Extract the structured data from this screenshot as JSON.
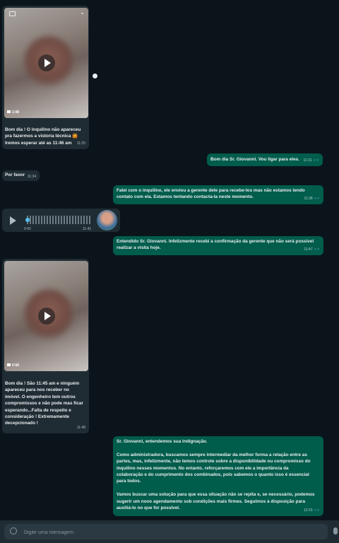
{
  "messages": {
    "m1": {
      "duration": "1:08",
      "text": "Bom dia ! O inquilino não apareceu\npra fazermos a vistoria técnica 🙆\nIremos esperar até as 11:46 am",
      "time": "11:25"
    },
    "m2": {
      "text": "Bom dia Sr. Giovanni. Vou ligar para eles.",
      "time": "11:31"
    },
    "m3": {
      "text": "Por favor",
      "time": "11:34"
    },
    "m4": {
      "text": "Falei com o inquilino, ele enviou a gerente dele para recebe-los mas não estamos tendo\ncontato com ela. Estamos tentando contacta-la neste momento.",
      "time": "11:38"
    },
    "m5": {
      "duration": "0:42",
      "time": "11:41",
      "progress": 0.0
    },
    "m6": {
      "text": "Entendido Sr. Giovanni. Infelizmente recebi a confirmação da gerente que não será possível\nrealizar a visita hoje.",
      "time": "11:47"
    },
    "m7": {
      "duration": "0:56",
      "text": "Bom dia ! São 11:45 am e ninguém\napareceu para nos receber no\nimóvel. O engenheiro tem outros\ncompromissos e não pode mas ficar\nesperando...Falta de respeito e\nconsideração ! Extremamente\ndecepcionado !",
      "time": "11:48"
    },
    "m8": {
      "text": "Sr. Giovanni, entendemos sua indignação.\n\nComo administradora, buscamos sempre intermediar da melhor forma a relação entre as\npartes, mas, infelizmente, não temos controle sobre a disponibilidade ou compromisso do\ninquilino nesses momentos. No entanto, reforçaremos com ele a importância da\ncolaboração e do cumprimento dos combinados, pois sabemos o quanto isso é essencial\npara todos.\n\nVamos buscar uma solução para que essa situação não se repita e, se necessário, podemos\nsugerir um novo agendamento sob condições mais firmes. Seguimos à disposição para\nauxiliá-lo no que for possível.",
      "time": "12:15"
    }
  },
  "composer": {
    "placeholder": "Digite uma mensagem"
  },
  "colors": {
    "background": "#0b141a",
    "incoming": "#202c33",
    "outgoing": "#005c4b",
    "read_check": "#53bdeb"
  }
}
